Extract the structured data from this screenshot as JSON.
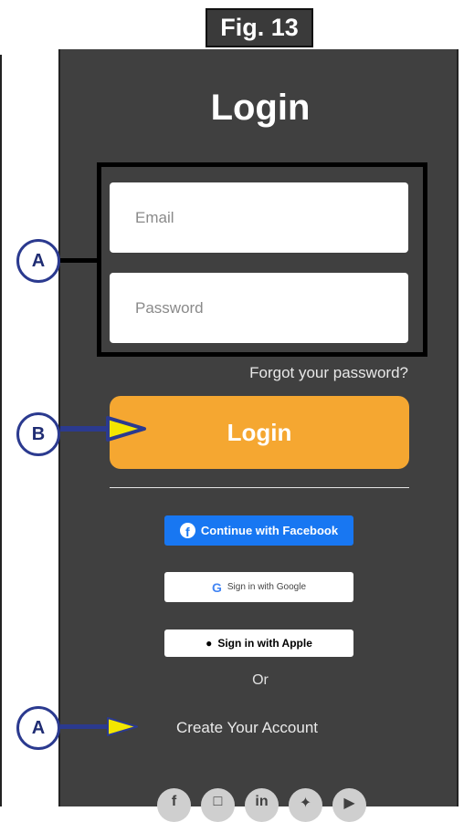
{
  "figure_label": "Fig. 13",
  "screen": {
    "title": "Login",
    "email_placeholder": "Email",
    "password_placeholder": "Password",
    "forgot_password": "Forgot your password?",
    "login_button": "Login",
    "facebook_button": "Continue with Facebook",
    "google_button": "Sign in with Google",
    "apple_button": "Sign in with Apple",
    "or_text": "Or",
    "create_account": "Create Your Account"
  },
  "icons": {
    "facebook": "facebook-icon",
    "google": "google-icon",
    "apple": "apple-icon",
    "social_row": [
      "facebook-icon",
      "instagram-icon",
      "linkedin-icon",
      "twitter-icon",
      "youtube-icon"
    ]
  },
  "callouts": {
    "fields": "A",
    "login": "B",
    "create": "A"
  },
  "colors": {
    "screen_background": "#404040",
    "login_button": "#f5a731",
    "facebook_button": "#1877f2",
    "callout_border": "#2b3a8f",
    "arrow_fill": "#f3e600"
  }
}
